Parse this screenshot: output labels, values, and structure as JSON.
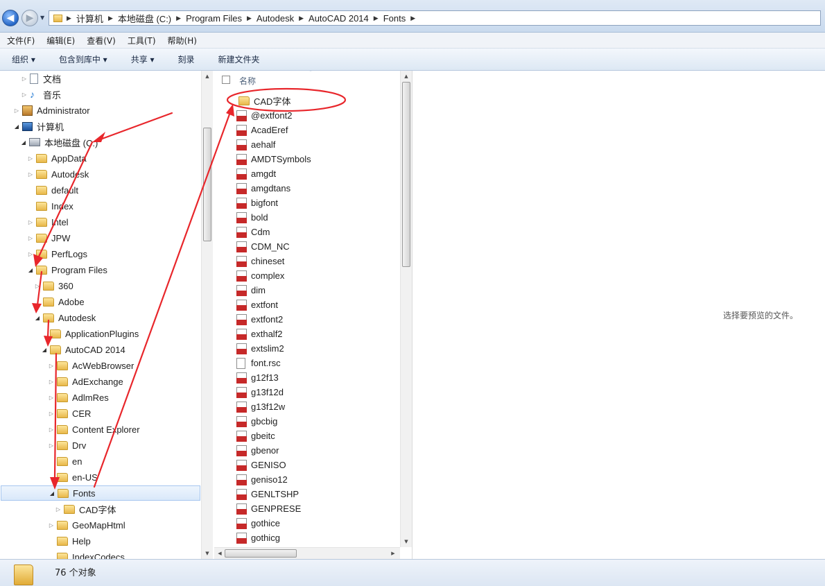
{
  "address_bar": {
    "crumbs": [
      "计算机",
      "本地磁盘 (C:)",
      "Program Files",
      "Autodesk",
      "AutoCAD 2014",
      "Fonts"
    ]
  },
  "menu": {
    "items": [
      "文件(F)",
      "编辑(E)",
      "查看(V)",
      "工具(T)",
      "帮助(H)"
    ]
  },
  "toolbar": {
    "items": [
      "组织 ▾",
      "包含到库中 ▾",
      "共享 ▾",
      "刻录",
      "新建文件夹"
    ]
  },
  "tree": {
    "items": [
      {
        "label": "文档",
        "icon": "document-library-icon"
      },
      {
        "label": "音乐",
        "icon": "music-library-icon"
      },
      {
        "label": "Administrator",
        "icon": "user-folder-icon"
      },
      {
        "label": "计算机",
        "icon": "computer-icon"
      },
      {
        "label": "本地磁盘 (C:)",
        "icon": "drive-icon"
      },
      {
        "label": "AppData",
        "icon": "folder-icon"
      },
      {
        "label": "Autodesk",
        "icon": "folder-icon"
      },
      {
        "label": "default",
        "icon": "folder-icon"
      },
      {
        "label": "Index",
        "icon": "folder-icon"
      },
      {
        "label": "Intel",
        "icon": "folder-icon"
      },
      {
        "label": "JPW",
        "icon": "folder-icon"
      },
      {
        "label": "PerfLogs",
        "icon": "folder-icon"
      },
      {
        "label": "Program Files",
        "icon": "folder-icon"
      },
      {
        "label": "360",
        "icon": "folder-icon"
      },
      {
        "label": "Adobe",
        "icon": "folder-icon"
      },
      {
        "label": "Autodesk",
        "icon": "folder-icon"
      },
      {
        "label": "ApplicationPlugins",
        "icon": "folder-icon"
      },
      {
        "label": "AutoCAD 2014",
        "icon": "folder-icon"
      },
      {
        "label": "AcWebBrowser",
        "icon": "folder-icon"
      },
      {
        "label": "AdExchange",
        "icon": "folder-icon"
      },
      {
        "label": "AdlmRes",
        "icon": "folder-icon"
      },
      {
        "label": "CER",
        "icon": "folder-icon"
      },
      {
        "label": "Content Explorer",
        "icon": "folder-icon"
      },
      {
        "label": "Drv",
        "icon": "folder-icon"
      },
      {
        "label": "en",
        "icon": "folder-icon"
      },
      {
        "label": "en-US",
        "icon": "folder-icon"
      },
      {
        "label": "Fonts",
        "icon": "folder-icon",
        "selected": true
      },
      {
        "label": "CAD字体",
        "icon": "folder-icon"
      },
      {
        "label": "GeoMapHtml",
        "icon": "folder-icon"
      },
      {
        "label": "Help",
        "icon": "folder-icon"
      },
      {
        "label": "IndexCodecs",
        "icon": "folder-icon"
      }
    ]
  },
  "file_list": {
    "column_header": "名称",
    "files": [
      {
        "name": "CAD字体",
        "icon": "folder-icon"
      },
      {
        "name": "@extfont2",
        "icon": "shx-file-icon"
      },
      {
        "name": "AcadEref",
        "icon": "shx-file-icon"
      },
      {
        "name": "aehalf",
        "icon": "shx-file-icon"
      },
      {
        "name": "AMDTSymbols",
        "icon": "shx-file-icon"
      },
      {
        "name": "amgdt",
        "icon": "shx-file-icon"
      },
      {
        "name": "amgdtans",
        "icon": "shx-file-icon"
      },
      {
        "name": "bigfont",
        "icon": "shx-file-icon"
      },
      {
        "name": "bold",
        "icon": "shx-file-icon"
      },
      {
        "name": "Cdm",
        "icon": "shx-file-icon"
      },
      {
        "name": "CDM_NC",
        "icon": "shx-file-icon"
      },
      {
        "name": "chineset",
        "icon": "shx-file-icon"
      },
      {
        "name": "complex",
        "icon": "shx-file-icon"
      },
      {
        "name": "dim",
        "icon": "shx-file-icon"
      },
      {
        "name": "extfont",
        "icon": "shx-file-icon"
      },
      {
        "name": "extfont2",
        "icon": "shx-file-icon"
      },
      {
        "name": "exthalf2",
        "icon": "shx-file-icon"
      },
      {
        "name": "extslim2",
        "icon": "shx-file-icon"
      },
      {
        "name": "font.rsc",
        "icon": "generic-file-icon"
      },
      {
        "name": "g12f13",
        "icon": "shx-file-icon"
      },
      {
        "name": "g13f12d",
        "icon": "shx-file-icon"
      },
      {
        "name": "g13f12w",
        "icon": "shx-file-icon"
      },
      {
        "name": "gbcbig",
        "icon": "shx-file-icon"
      },
      {
        "name": "gbeitc",
        "icon": "shx-file-icon"
      },
      {
        "name": "gbenor",
        "icon": "shx-file-icon"
      },
      {
        "name": "GENISO",
        "icon": "shx-file-icon"
      },
      {
        "name": "geniso12",
        "icon": "shx-file-icon"
      },
      {
        "name": "GENLTSHP",
        "icon": "shx-file-icon"
      },
      {
        "name": "GENPRESE",
        "icon": "shx-file-icon"
      },
      {
        "name": "gothice",
        "icon": "shx-file-icon"
      },
      {
        "name": "gothicg",
        "icon": "shx-file-icon"
      }
    ]
  },
  "preview": {
    "message": "选择要预览的文件。"
  },
  "status": {
    "count_text": "76 个对象"
  },
  "colors": {
    "annotation": "#e8262b",
    "selection": "#d9e8fa",
    "folder": "#f2cd6a"
  }
}
